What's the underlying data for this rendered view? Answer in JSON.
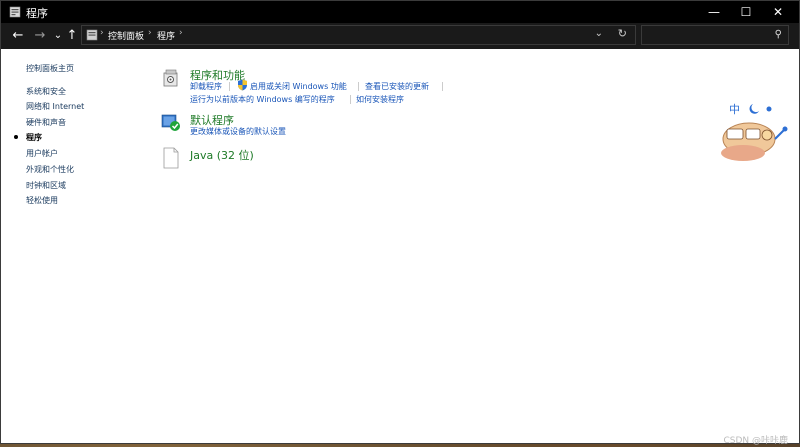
{
  "window": {
    "title": "程序",
    "controls": {
      "minimize": "—",
      "maximize": "☐",
      "close": "✕"
    }
  },
  "nav": {
    "back": "←",
    "forward": "→",
    "recent": "⌄",
    "up": "↑",
    "breadcrumb": [
      "控制面板",
      "程序"
    ],
    "separator": "›",
    "dropdown": "⌄",
    "refresh": "↻"
  },
  "search": {
    "placeholder": "",
    "icon": "⚲"
  },
  "sidebar": {
    "home": "控制面板主页",
    "items": [
      {
        "label": "系统和安全",
        "active": false
      },
      {
        "label": "网络和 Internet",
        "active": false
      },
      {
        "label": "硬件和声音",
        "active": false
      },
      {
        "label": "程序",
        "active": true
      },
      {
        "label": "用户帐户",
        "active": false
      },
      {
        "label": "外观和个性化",
        "active": false
      },
      {
        "label": "时钟和区域",
        "active": false
      },
      {
        "label": "轻松使用",
        "active": false
      }
    ]
  },
  "categories": {
    "programs": {
      "title": "程序和功能",
      "links": {
        "uninstall": "卸载程序",
        "features": "启用或关闭 Windows 功能",
        "updates": "查看已安装的更新",
        "compat": "运行为以前版本的 Windows 编写的程序",
        "howto": "如何安装程序"
      }
    },
    "defaults": {
      "title": "默认程序",
      "links": {
        "media": "更改媒体或设备的默认设置"
      }
    },
    "java": {
      "title": "Java (32 位)"
    }
  },
  "mascot": {
    "badge": "中"
  },
  "watermark": "CSDN @咔咔鹿",
  "colors": {
    "link": "#1a56b8",
    "category_title": "#1e7a27",
    "titlebar": "#000000"
  }
}
